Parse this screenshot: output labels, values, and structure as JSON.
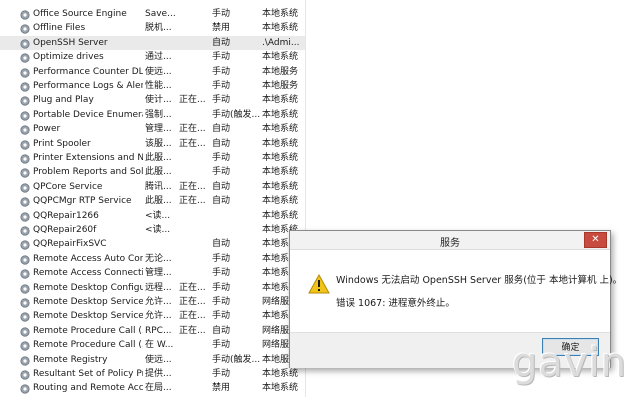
{
  "services": [
    {
      "name": "Office  Source Engine",
      "desc": "Save...",
      "status": "",
      "startup": "手动",
      "logon": "本地系统"
    },
    {
      "name": "Offline Files",
      "desc": "脱机...",
      "status": "",
      "startup": "禁用",
      "logon": "本地系统"
    },
    {
      "name": "OpenSSH Server",
      "desc": "",
      "status": "",
      "startup": "自动",
      "logon": ".\\Admi..."
    },
    {
      "name": "Optimize drives",
      "desc": "通过...",
      "status": "",
      "startup": "手动",
      "logon": "本地系统"
    },
    {
      "name": "Performance Counter DL...",
      "desc": "使远...",
      "status": "",
      "startup": "手动",
      "logon": "本地服务"
    },
    {
      "name": "Performance Logs & Aler...",
      "desc": "性能...",
      "status": "",
      "startup": "手动",
      "logon": "本地服务"
    },
    {
      "name": "Plug and Play",
      "desc": "使计...",
      "status": "正在...",
      "startup": "手动",
      "logon": "本地系统"
    },
    {
      "name": "Portable Device Enumera...",
      "desc": "强制...",
      "status": "",
      "startup": "手动(触发...",
      "logon": "本地系统"
    },
    {
      "name": "Power",
      "desc": "管理...",
      "status": "正在...",
      "startup": "自动",
      "logon": "本地系统"
    },
    {
      "name": "Print Spooler",
      "desc": "该服...",
      "status": "正在...",
      "startup": "自动",
      "logon": "本地系统"
    },
    {
      "name": "Printer Extensions and N...",
      "desc": "此服...",
      "status": "",
      "startup": "手动",
      "logon": "本地系统"
    },
    {
      "name": "Problem Reports and Sol...",
      "desc": "此服...",
      "status": "",
      "startup": "手动",
      "logon": "本地系统"
    },
    {
      "name": "QPCore Service",
      "desc": "腾讯...",
      "status": "正在...",
      "startup": "自动",
      "logon": "本地系统"
    },
    {
      "name": "QQPCMgr RTP Service",
      "desc": "此服...",
      "status": "正在...",
      "startup": "自动",
      "logon": "本地系统"
    },
    {
      "name": "QQRepair1266",
      "desc": "<读...",
      "status": "",
      "startup": "",
      "logon": "本地系统"
    },
    {
      "name": "QQRepair260f",
      "desc": "<读...",
      "status": "",
      "startup": "",
      "logon": "本地系统"
    },
    {
      "name": "QQRepairFixSVC",
      "desc": "",
      "status": "",
      "startup": "自动",
      "logon": "本地系统"
    },
    {
      "name": "Remote Access Auto Con...",
      "desc": "无论...",
      "status": "",
      "startup": "手动",
      "logon": "本地系统"
    },
    {
      "name": "Remote Access Connecti...",
      "desc": "管理...",
      "status": "",
      "startup": "手动",
      "logon": "本地系统"
    },
    {
      "name": "Remote Desktop Configu...",
      "desc": "远程...",
      "status": "正在...",
      "startup": "手动",
      "logon": "本地系统"
    },
    {
      "name": "Remote Desktop Services",
      "desc": "允许...",
      "status": "正在...",
      "startup": "手动",
      "logon": "网络服务"
    },
    {
      "name": "Remote Desktop Service...",
      "desc": "允许...",
      "status": "正在...",
      "startup": "手动",
      "logon": "本地系统"
    },
    {
      "name": "Remote Procedure Call (...",
      "desc": "RPC...",
      "status": "正在...",
      "startup": "自动",
      "logon": "网络服务"
    },
    {
      "name": "Remote Procedure Call (...",
      "desc": "在 W...",
      "status": "",
      "startup": "手动",
      "logon": "网络服务"
    },
    {
      "name": "Remote Registry",
      "desc": "使远...",
      "status": "",
      "startup": "手动(触发...",
      "logon": "本地服务"
    },
    {
      "name": "Resultant Set of Policy Pr...",
      "desc": "提供...",
      "status": "",
      "startup": "手动",
      "logon": "本地系统"
    },
    {
      "name": "Routing and Remote Acc...",
      "desc": "在局...",
      "status": "",
      "startup": "禁用",
      "logon": "本地系统"
    }
  ],
  "dialog": {
    "title": "服务",
    "close_label": "✕",
    "message": "Windows 无法启动 OpenSSH Server 服务(位于 本地计算机 上)。",
    "error": "错误 1067: 进程意外终止。",
    "ok_label": "确定"
  },
  "watermark": "gavin",
  "colors": {
    "close_button": "#c74b3f",
    "warning": "#f0c419",
    "ok_border": "#3c7fb1"
  }
}
